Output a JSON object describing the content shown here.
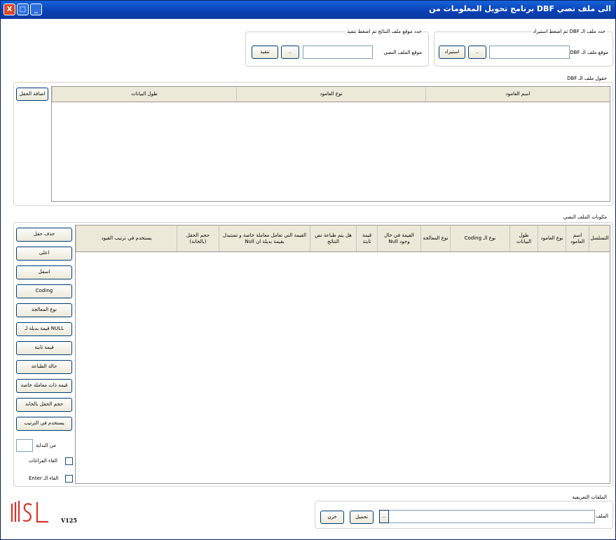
{
  "window": {
    "title": "برنامج تحويل المعلومات من DBF الى ملف نصي",
    "close_glyph": "X",
    "max_glyph": "□",
    "min_glyph": "_"
  },
  "source": {
    "group_label": "حدد ملف الـ DBF ثم اضغط استيراد",
    "file_label": "موقع ملف الـ DBF",
    "browse_label": "..",
    "import_label": "استيراد"
  },
  "target": {
    "group_label": "حدد موقع ملف النتائج ثم اضغط تنفيذ",
    "file_label": "موقع الملف النصي",
    "browse_label": "..",
    "execute_label": "تنفيذ"
  },
  "dbf_section": {
    "label": "حقول ملف الـ DBF",
    "add_field_label": "اضافة الحقل",
    "columns": [
      "اسم العامود",
      "نوع العامود",
      "طول البيانات"
    ]
  },
  "text_section": {
    "label": "مكونات الملف النصي",
    "columns": [
      "التسلسل",
      "اسم العامود",
      "نوع العامود",
      "طول البيانات",
      "نوع الـ Coding",
      "نوع المعالجة",
      "القيمة في حال وجود Null",
      "قيمة ثابتة",
      "هل يتم طباعة نص النتائج",
      "القيمة التي تعامل معاملة خاصة و تستبدل بقيمة بديلة ان Null",
      "حجم الحقل (بالخانة)",
      "يستخدم في ترتيب القيود"
    ],
    "buttons": [
      "حذف حقل",
      "اعلى",
      "اسفل",
      "Coding",
      "نوع المعالجة",
      "قيمة بديلة لـ NULL",
      "قيمة ثابتة",
      "حالة الطباعة",
      "قيمة ذات معاملة خاصة",
      "حجم الحقل بالخانة",
      "يستخدم في الترتيب"
    ],
    "start_label": "من البداية",
    "cancel_spaces_label": "الغاء الفراغات",
    "cancel_enter_label": "الغاء الـ Enter"
  },
  "definition": {
    "section_label": "الملفات التعريفية",
    "file_label": "الملف",
    "browse_label": "..",
    "load_label": "تحميل",
    "save_label": "خزن"
  },
  "footer": {
    "logo_text": "IIISL",
    "version": "V125"
  }
}
